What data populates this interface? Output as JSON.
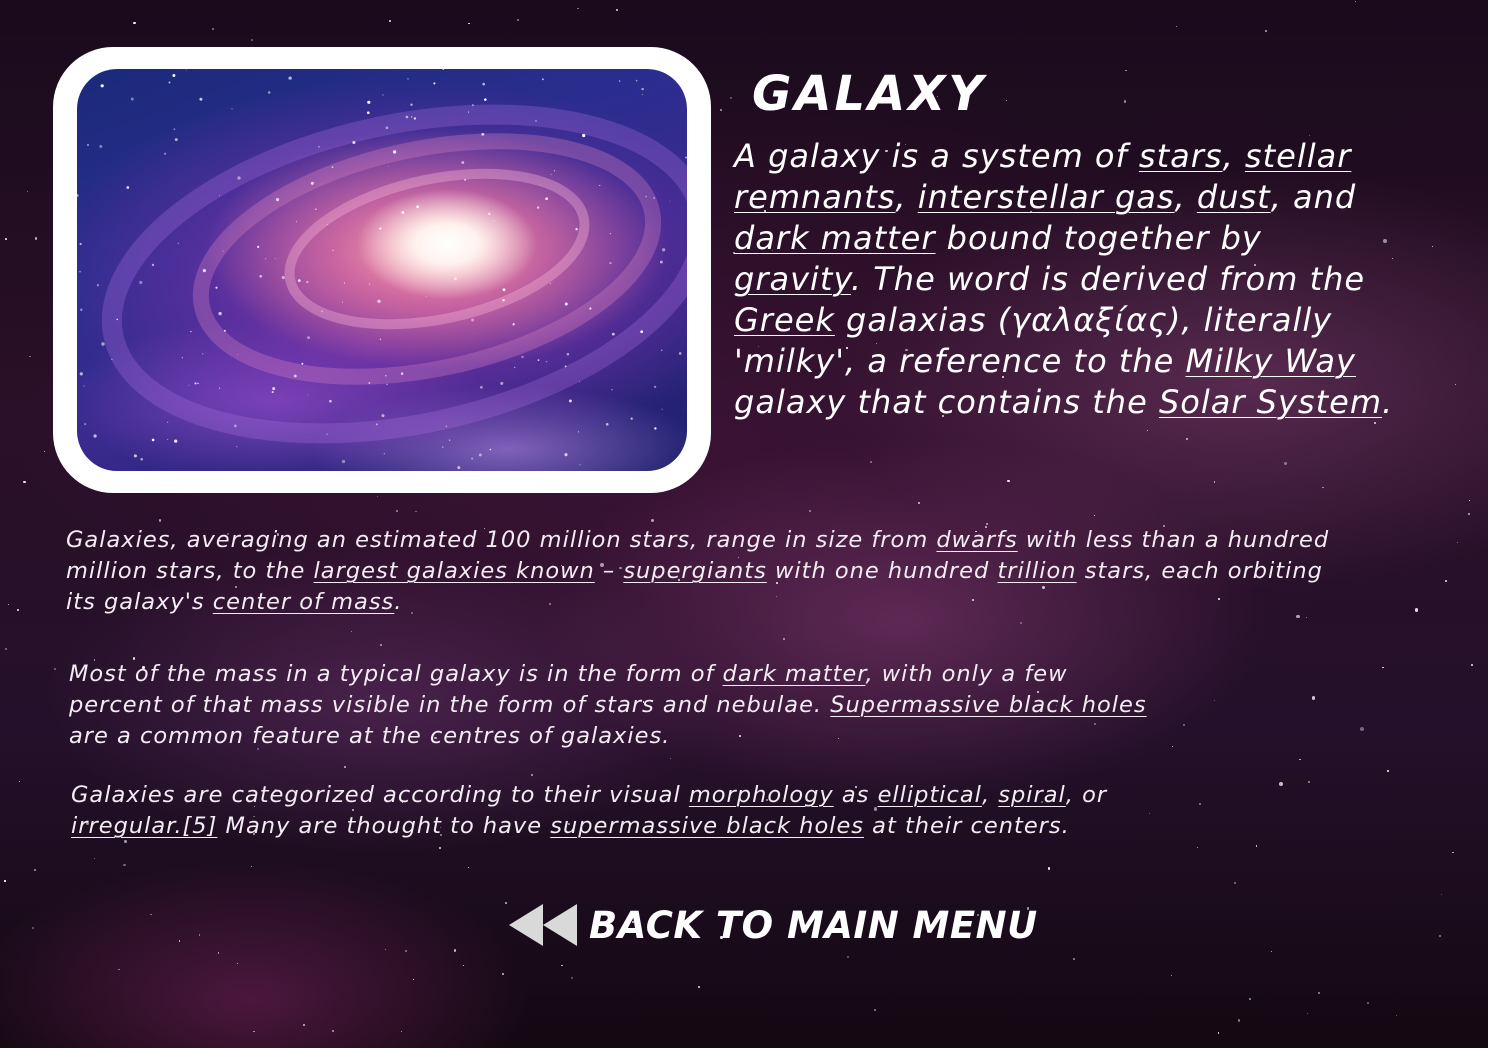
{
  "page": {
    "title": "GALAXY",
    "image_alt": "Spiral galaxy"
  },
  "intro": {
    "t1": "A galaxy is a system of ",
    "l1": "stars",
    "t2": ", ",
    "l2": "stellar remnants",
    "t3": ", ",
    "l3": "interstellar gas",
    "t4": ", ",
    "l4": "dust",
    "t5": ", and ",
    "l5": "dark matter",
    "t6": " bound together by ",
    "l6": "gravity",
    "t7": ". The word is derived from the ",
    "l7": "Greek",
    "t8": " galaxias (γαλαξίας), literally 'milky', a reference to the ",
    "l8": "Milky Way",
    "t9": " galaxy that contains the ",
    "l9": "Solar System",
    "t10": "."
  },
  "para1": {
    "t1": "Galaxies, averaging an estimated 100 million stars, range in size from ",
    "l1": "dwarfs",
    "t2": " with less than a hundred million stars, to the ",
    "l2": "largest galaxies known",
    "t3": " – ",
    "l3": "supergiants",
    "t4": " with one hundred ",
    "l4": "trillion",
    "t5": " stars, each orbiting its galaxy's ",
    "l5": "center of mass",
    "t6": "."
  },
  "para2": {
    "t1": "Most of the mass in a typical galaxy is in the form of ",
    "l1": "dark matter",
    "t2": ", with only a few percent of that mass visible in the form of stars and nebulae. ",
    "l2": "Supermassive black holes",
    "t3": " are a common feature at the centres of galaxies."
  },
  "para3": {
    "t1": "Galaxies are categorized according to their visual ",
    "l1": "morphology",
    "t2": " as ",
    "l2": "elliptical",
    "t3": ", ",
    "l3": "spiral",
    "t4": ", or ",
    "l4": "irregular.",
    "l5": "[5]",
    "t5": " Many are thought to have ",
    "l6": "supermassive black holes",
    "t6": " at their centers."
  },
  "navigation": {
    "back_label": "BACK TO MAIN MENU",
    "back_icon": "rewind-arrow-icon"
  }
}
